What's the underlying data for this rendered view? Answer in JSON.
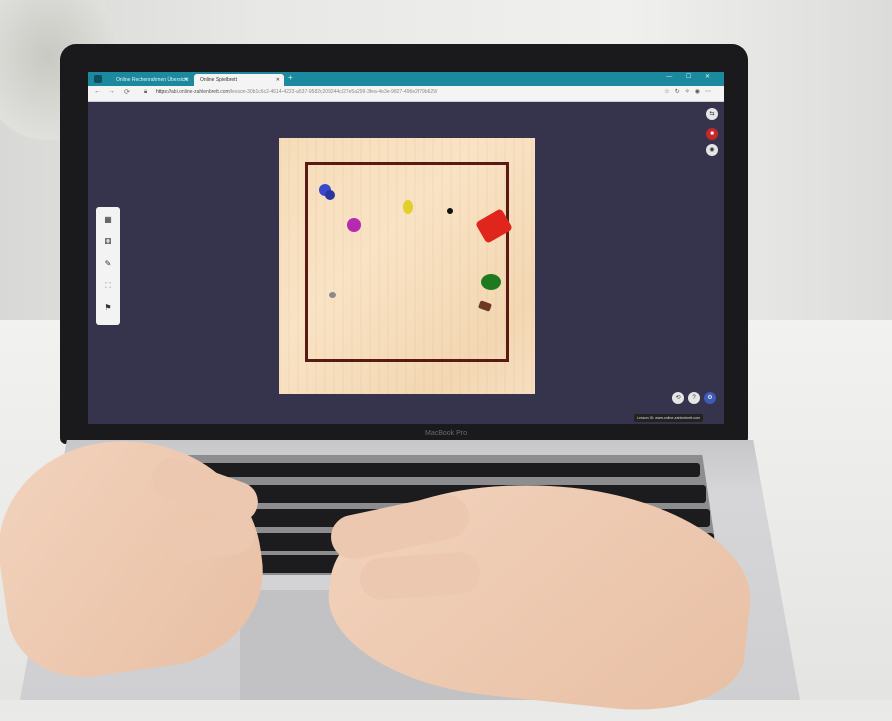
{
  "browser": {
    "tabs": [
      {
        "label": "Online Rechenrahmen Übersicht"
      },
      {
        "label": "Online Spielbrett"
      }
    ],
    "new_tab_symbol": "+",
    "window_controls": "— ☐ ✕",
    "nav": {
      "back": "←",
      "forward": "→",
      "reload": "⟳"
    },
    "address": {
      "prefix": "https://",
      "host": "abi.online-zahlenbrett.com",
      "path": "/lesson-30b1c6c2-4614-4223-a537-9582c209244c/27e5a299-3fea-4e3e-9827-496e2f79b629/"
    },
    "toolbar_icons": [
      "star-icon",
      "refresh-icon",
      "extensions-icon",
      "profile-icon",
      "more-icon"
    ]
  },
  "app": {
    "left_toolbar": [
      {
        "name": "tool-board",
        "glyph": "▦"
      },
      {
        "name": "tool-dice",
        "glyph": "⚅"
      },
      {
        "name": "tool-pen",
        "glyph": "✎"
      },
      {
        "name": "tool-fullscreen",
        "glyph": "⛶"
      },
      {
        "name": "tool-add-person",
        "glyph": "⚑"
      }
    ],
    "right_top_buttons": [
      {
        "name": "share-icon",
        "glyph": "⇆",
        "color": "#e6e6e6"
      },
      {
        "name": "stop-icon",
        "glyph": "■",
        "color": "#c62828"
      },
      {
        "name": "camera-icon",
        "glyph": "◉",
        "color": "#e6e6e6"
      }
    ],
    "bottom_buttons": [
      {
        "name": "back-icon",
        "glyph": "⟲",
        "color": "#e6e6e6"
      },
      {
        "name": "help-icon",
        "glyph": "?",
        "color": "#e6e6e6"
      },
      {
        "name": "settings-icon",
        "glyph": "⚙",
        "color": "#3f5ab8"
      }
    ],
    "tooltip": "Lesson ID: www.online-zahlenbrett.com"
  },
  "device": {
    "brand": "MacBook Pro"
  },
  "colors": {
    "tabbar": "#1b8a9e",
    "app_bg": "#36344c",
    "board": "#f8e0c0",
    "frame": "#5a1a14",
    "piece_blue": "#3b49c8",
    "piece_purple": "#b52ab0",
    "piece_yellow": "#e2cf2a",
    "piece_black": "#111111",
    "piece_red": "#e0261c",
    "piece_green": "#1f7a1f",
    "piece_brown": "#6b3a20",
    "piece_gray": "#8a8a8a"
  }
}
